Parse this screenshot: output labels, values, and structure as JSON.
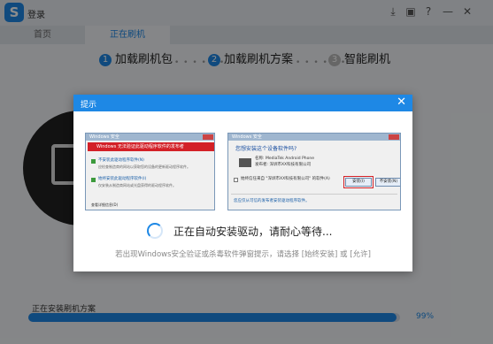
{
  "app": {
    "login_label": "登录",
    "logo_text": "S",
    "window_icons": [
      "download-icon",
      "package-icon",
      "help-icon",
      "minimize-icon",
      "close-icon"
    ],
    "window_icon_glyphs": [
      "⤓",
      "▣",
      "?",
      "—",
      "✕"
    ]
  },
  "tabs": [
    {
      "label": "首页",
      "active": false
    },
    {
      "label": "正在刷机",
      "active": true
    }
  ],
  "steps": [
    {
      "num": "1",
      "label": "加载刷机包",
      "active": true
    },
    {
      "num": "2",
      "label": "加载刷机方案",
      "active": true
    },
    {
      "num": "3",
      "label": "智能刷机",
      "active": false
    }
  ],
  "step_separator": "• • • • • •",
  "progress": {
    "label": "正在安装刷机方案",
    "percent_text": "99%",
    "value": 0.99
  },
  "dialog": {
    "title": "提示",
    "close_glyph": "✕",
    "screenshot1": {
      "window_title": "Windows 安全",
      "warning": "Windows 无法验证此驱动程序软件的发布者",
      "option1": "不安装此驱动程序软件(N)",
      "option1_sub": "应检查制造商的网站以获取您的设备的更新驱动程序软件。",
      "option2": "始终安装此驱动程序软件(I)",
      "option2_sub": "仅安装从制造商网站或光盘获得的驱动程序软件。",
      "details": "查看详细信息(D)"
    },
    "screenshot2": {
      "window_title": "Windows 安全",
      "question": "您想安装这个设备软件吗?",
      "device_name": "名称: MediaTek Android Phone",
      "publisher": "发布者: 深圳市XX科技有限公司",
      "checkbox_label": "始终信任来自 \"深圳市XX科技有限公司\" 的软件(A)",
      "install_btn": "安装(I)",
      "no_install_btn": "不安装(N)",
      "footer": "您应仅从可信的发布者安装驱动程序软件。"
    },
    "status": "正在自动安装驱动，请耐心等待...",
    "hint": "若出现Windows安全验证或杀毒软件弹窗提示，请选择 [始终安装] 或 [允许]"
  },
  "colors": {
    "accent": "#1e88e5",
    "warning": "#d32027"
  }
}
